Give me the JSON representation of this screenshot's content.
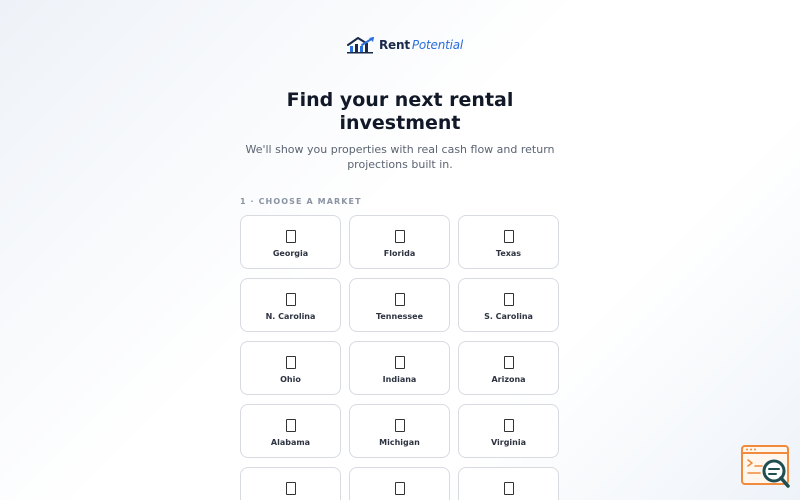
{
  "brand": {
    "name_bold": "Rent",
    "name_italic": "Potential",
    "logo_icon": "house-chart-icon",
    "primary_color": "#2a6fdb",
    "dark_color": "#1b2a4a"
  },
  "hero": {
    "title": "Find your next rental investment",
    "subtitle": "We'll show you properties with real cash flow and return projections built in."
  },
  "step": {
    "label": "1 · Choose a market"
  },
  "markets": [
    {
      "label": "Georgia",
      "icon": "missing-glyph-icon"
    },
    {
      "label": "Florida",
      "icon": "missing-glyph-icon"
    },
    {
      "label": "Texas",
      "icon": "missing-glyph-icon"
    },
    {
      "label": "N. Carolina",
      "icon": "missing-glyph-icon"
    },
    {
      "label": "Tennessee",
      "icon": "missing-glyph-icon"
    },
    {
      "label": "S. Carolina",
      "icon": "missing-glyph-icon"
    },
    {
      "label": "Ohio",
      "icon": "missing-glyph-icon"
    },
    {
      "label": "Indiana",
      "icon": "missing-glyph-icon"
    },
    {
      "label": "Arizona",
      "icon": "missing-glyph-icon"
    },
    {
      "label": "Alabama",
      "icon": "missing-glyph-icon"
    },
    {
      "label": "Michigan",
      "icon": "missing-glyph-icon"
    },
    {
      "label": "Virginia",
      "icon": "missing-glyph-icon"
    },
    {
      "label": "",
      "icon": "missing-glyph-icon"
    },
    {
      "label": "",
      "icon": "missing-glyph-icon"
    },
    {
      "label": "",
      "icon": "missing-glyph-icon"
    }
  ],
  "help_widget": {
    "icon": "support-search-icon",
    "accent_color": "#f08a3c",
    "dark_color": "#1f4e52"
  }
}
